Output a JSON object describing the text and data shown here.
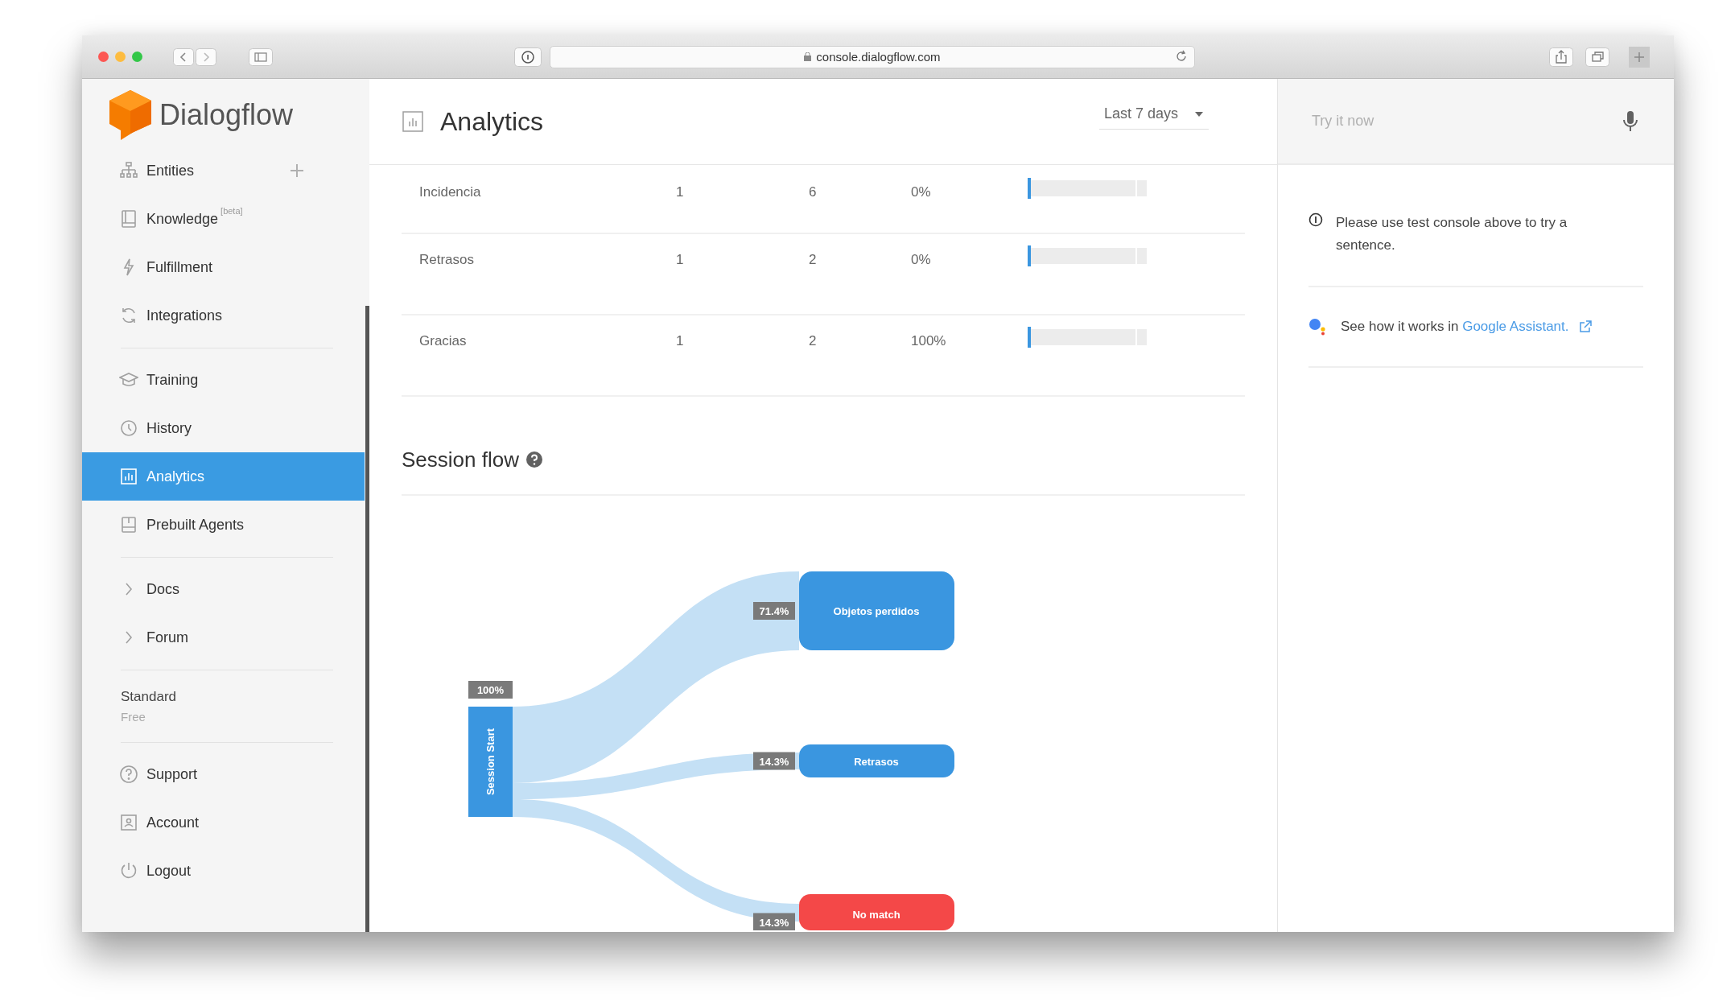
{
  "browser": {
    "url": "console.dialogflow.com"
  },
  "sidebar": {
    "logo": "Dialogflow",
    "sections": [
      {
        "items": [
          {
            "label": "Entities",
            "kind": "nav-add",
            "selected": false
          },
          {
            "label": "Knowledge",
            "badge": "[beta]",
            "kind": "nav",
            "selected": false
          },
          {
            "label": "Fulfillment",
            "kind": "nav",
            "selected": false
          },
          {
            "label": "Integrations",
            "kind": "nav",
            "selected": false
          }
        ]
      },
      {
        "items": [
          {
            "label": "Training",
            "kind": "nav",
            "selected": false
          },
          {
            "label": "History",
            "kind": "nav",
            "selected": false
          },
          {
            "label": "Analytics",
            "kind": "nav",
            "selected": true
          },
          {
            "label": "Prebuilt Agents",
            "kind": "nav",
            "selected": false
          }
        ]
      },
      {
        "items": [
          {
            "label": "Docs",
            "kind": "expand",
            "selected": false
          },
          {
            "label": "Forum",
            "kind": "expand",
            "selected": false
          }
        ]
      }
    ],
    "plan": {
      "name": "Standard",
      "tier": "Free"
    },
    "account_items": [
      {
        "label": "Support",
        "selected": false
      },
      {
        "label": "Account",
        "selected": false
      },
      {
        "label": "Logout",
        "selected": false
      }
    ]
  },
  "header": {
    "title": "Analytics",
    "range": "Last 7 days"
  },
  "table": {
    "rows": [
      {
        "name": "Incidencia",
        "column_2": "1",
        "column_3": "6",
        "column_4": "0%"
      },
      {
        "name": "Retrasos",
        "column_2": "1",
        "column_3": "2",
        "column_4": "0%"
      },
      {
        "name": "Gracias",
        "column_2": "1",
        "column_3": "2",
        "column_4": "100%"
      }
    ]
  },
  "session_flow": {
    "title": "Session flow",
    "start": {
      "label": "Session Start",
      "share": "100%"
    },
    "targets": [
      {
        "label": "Objetos perdidos",
        "share": "71.4%",
        "color": "#3a96e0"
      },
      {
        "label": "Retrasos",
        "share": "14.3%",
        "color": "#3a96e0"
      },
      {
        "label": "No match",
        "share": "14.3%",
        "color": "#f44848"
      }
    ]
  },
  "console": {
    "placeholder": "Try it now",
    "info": "Please use test console above to try a sentence.",
    "assistant_text": "See how it works in ",
    "assistant_link": "Google Assistant."
  }
}
